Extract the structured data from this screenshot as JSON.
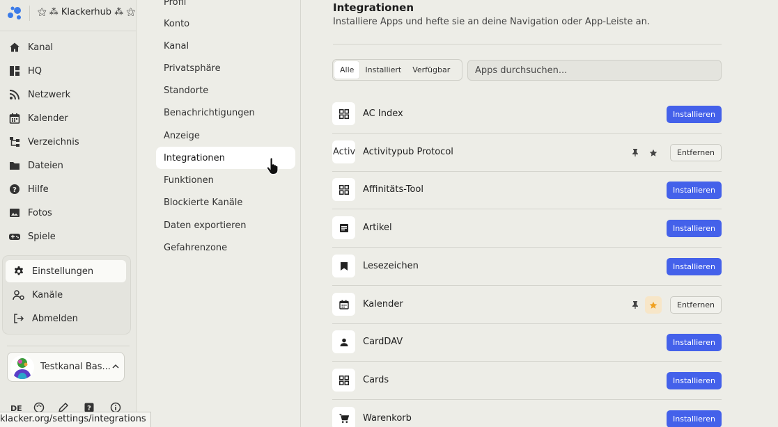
{
  "brand": {
    "name": "⚝ ⁂ Klackerhub ⁂ ⚝",
    "logo_color": "#3b7be8"
  },
  "nav": [
    {
      "label": "Kanal",
      "icon": "home-icon"
    },
    {
      "label": "HQ",
      "icon": "dashboard-icon"
    },
    {
      "label": "Netzwerk",
      "icon": "rss-icon"
    },
    {
      "label": "Kalender",
      "icon": "calendar-icon"
    },
    {
      "label": "Verzeichnis",
      "icon": "sitemap-icon"
    },
    {
      "label": "Dateien",
      "icon": "folder-icon"
    },
    {
      "label": "Hilfe",
      "icon": "help-icon"
    },
    {
      "label": "Fotos",
      "icon": "image-icon"
    },
    {
      "label": "Spiele",
      "icon": "gamepad-icon"
    }
  ],
  "menu": [
    {
      "label": "Einstellungen",
      "icon": "gear-icon",
      "active": true
    },
    {
      "label": "Kanäle",
      "icon": "user-cog-icon",
      "active": false
    },
    {
      "label": "Abmelden",
      "icon": "logout-icon",
      "active": false
    }
  ],
  "user": {
    "name": "Testkanal Bas..."
  },
  "footer": {
    "lang": "DE"
  },
  "status_url": "klacker.org/settings/integrations",
  "settings_menu": [
    {
      "label": "Profil",
      "active": false
    },
    {
      "label": "Konto",
      "active": false
    },
    {
      "label": "Kanal",
      "active": false
    },
    {
      "label": "Privatsphäre",
      "active": false
    },
    {
      "label": "Standorte",
      "active": false
    },
    {
      "label": "Benachrichtigungen",
      "active": false
    },
    {
      "label": "Anzeige",
      "active": false
    },
    {
      "label": "Integrationen",
      "active": true
    },
    {
      "label": "Funktionen",
      "active": false
    },
    {
      "label": "Blockierte Kanäle",
      "active": false
    },
    {
      "label": "Daten exportieren",
      "active": false
    },
    {
      "label": "Gefahrenzone",
      "active": false
    }
  ],
  "main": {
    "title": "Integrationen",
    "subtitle": "Installiere Apps und hefte sie an deine Navigation oder App-Leiste an.",
    "tabs": [
      {
        "label": "Alle",
        "active": true
      },
      {
        "label": "Installiert",
        "active": false
      },
      {
        "label": "Verfügbar",
        "active": false
      }
    ],
    "search_placeholder": "Apps durchsuchen...",
    "install_label": "Installieren",
    "remove_label": "Entfernen",
    "accent_color": "#4461ea",
    "apps": [
      {
        "name": "AC Index",
        "icon": "grid-icon",
        "installed": false
      },
      {
        "name": "Activitypub Protocol",
        "icon": "text-icon",
        "icon_text": "Activ Prot",
        "installed": true,
        "starred": false
      },
      {
        "name": "Affinitäts-Tool",
        "icon": "grid-icon",
        "installed": false
      },
      {
        "name": "Artikel",
        "icon": "article-icon",
        "installed": false
      },
      {
        "name": "Lesezeichen",
        "icon": "bookmark-icon",
        "installed": false
      },
      {
        "name": "Kalender",
        "icon": "calendar-icon",
        "installed": true,
        "starred": true
      },
      {
        "name": "CardDAV",
        "icon": "person-icon",
        "installed": false
      },
      {
        "name": "Cards",
        "icon": "grid-icon",
        "installed": false
      },
      {
        "name": "Warenkorb",
        "icon": "cart-icon",
        "installed": false
      }
    ]
  }
}
